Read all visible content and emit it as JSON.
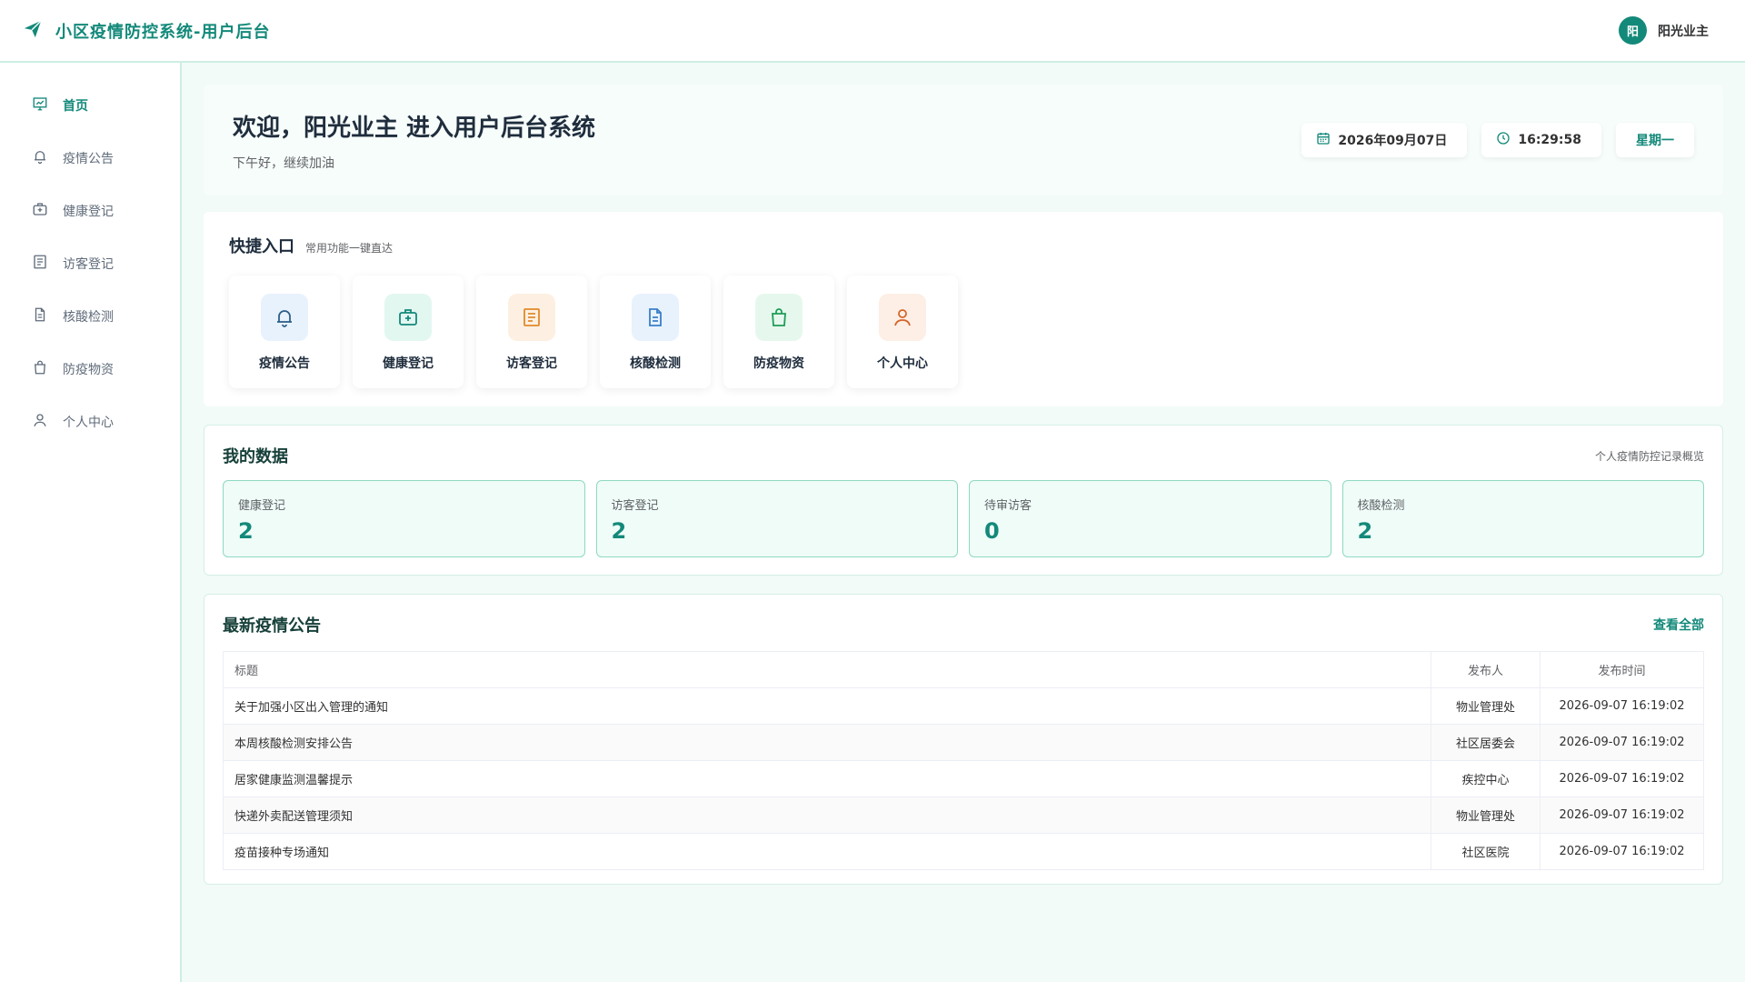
{
  "header": {
    "title": "小区疫情防控系统-用户后台",
    "avatar_char": "阳",
    "user_name": "阳光业主"
  },
  "sidebar": {
    "items": [
      {
        "label": "首页",
        "icon": "dashboard-icon"
      },
      {
        "label": "疫情公告",
        "icon": "bell-icon"
      },
      {
        "label": "健康登记",
        "icon": "medical-kit-icon"
      },
      {
        "label": "访客登记",
        "icon": "form-icon"
      },
      {
        "label": "核酸检测",
        "icon": "document-icon"
      },
      {
        "label": "防疫物资",
        "icon": "shopping-bag-icon"
      },
      {
        "label": "个人中心",
        "icon": "user-icon"
      }
    ]
  },
  "welcome": {
    "title": "欢迎，阳光业主 进入用户后台系统",
    "subtitle": "下午好，继续加油",
    "date": "2026年09月07日",
    "time": "16:29:58",
    "weekday": "星期一"
  },
  "quick": {
    "title": "快捷入口",
    "subtitle": "常用功能一键直达",
    "tiles": [
      {
        "label": "疫情公告",
        "icon": "bell-icon",
        "bg": "#e8f2fd",
        "color": "#2d5f8a"
      },
      {
        "label": "健康登记",
        "icon": "medical-kit-icon",
        "bg": "#e3f7f1",
        "color": "#13897a"
      },
      {
        "label": "访客登记",
        "icon": "form-icon",
        "bg": "#fdf0e2",
        "color": "#e08a2c"
      },
      {
        "label": "核酸检测",
        "icon": "document-icon",
        "bg": "#e8f2fd",
        "color": "#3a7fc8"
      },
      {
        "label": "防疫物资",
        "icon": "shopping-bag-icon",
        "bg": "#e6f8ee",
        "color": "#1f9d57"
      },
      {
        "label": "个人中心",
        "icon": "user-icon",
        "bg": "#fdefe6",
        "color": "#d4652a"
      }
    ]
  },
  "mydata": {
    "title": "我的数据",
    "subtitle": "个人疫情防控记录概览",
    "stats": [
      {
        "label": "健康登记",
        "value": "2"
      },
      {
        "label": "访客登记",
        "value": "2"
      },
      {
        "label": "待审访客",
        "value": "0"
      },
      {
        "label": "核酸检测",
        "value": "2"
      }
    ]
  },
  "notices": {
    "title": "最新疫情公告",
    "view_all": "查看全部",
    "columns": [
      "标题",
      "发布人",
      "发布时间"
    ],
    "rows": [
      [
        "关于加强小区出入管理的通知",
        "物业管理处",
        "2026-09-07 16:19:02"
      ],
      [
        "本周核酸检测安排公告",
        "社区居委会",
        "2026-09-07 16:19:02"
      ],
      [
        "居家健康监测温馨提示",
        "疾控中心",
        "2026-09-07 16:19:02"
      ],
      [
        "快递外卖配送管理须知",
        "物业管理处",
        "2026-09-07 16:19:02"
      ],
      [
        "疫苗接种专场通知",
        "社区医院",
        "2026-09-07 16:19:02"
      ]
    ]
  },
  "colors": {
    "accent": "#13897a",
    "background": "#f2fbf8",
    "stat_border": "#8fd9c3"
  }
}
